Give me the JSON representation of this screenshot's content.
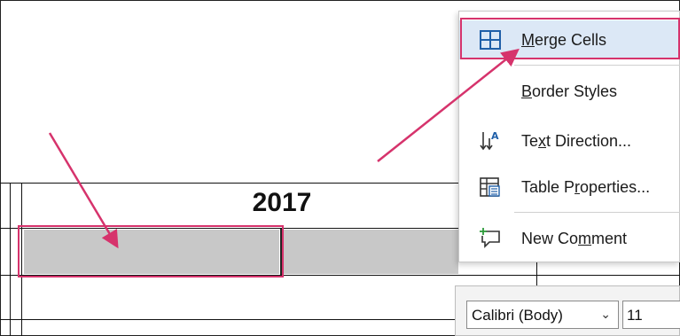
{
  "document": {
    "table_header": "2017"
  },
  "context_menu": {
    "items": [
      {
        "label_pre": "",
        "label_key": "M",
        "label_post": "erge Cells",
        "icon": "merge-cells-icon",
        "highlighted": true
      },
      {
        "label_pre": "",
        "label_key": "B",
        "label_post": "order Styles",
        "icon": "",
        "highlighted": false
      },
      {
        "label_pre": "Te",
        "label_key": "x",
        "label_post": "t Direction...",
        "icon": "text-direction-icon",
        "highlighted": false
      },
      {
        "label_pre": "Table P",
        "label_key": "r",
        "label_post": "operties...",
        "icon": "table-properties-icon",
        "highlighted": false
      },
      {
        "label_pre": "New Co",
        "label_key": "m",
        "label_post": "ment",
        "icon": "new-comment-icon",
        "highlighted": false
      }
    ]
  },
  "mini_toolbar": {
    "font_name": "Calibri (Body)",
    "font_size": "11"
  },
  "colors": {
    "annotation": "#d6336c",
    "highlight": "#dce8f6",
    "selected_cell": "#c8c8c8",
    "icon_blue": "#1f5fa8"
  }
}
